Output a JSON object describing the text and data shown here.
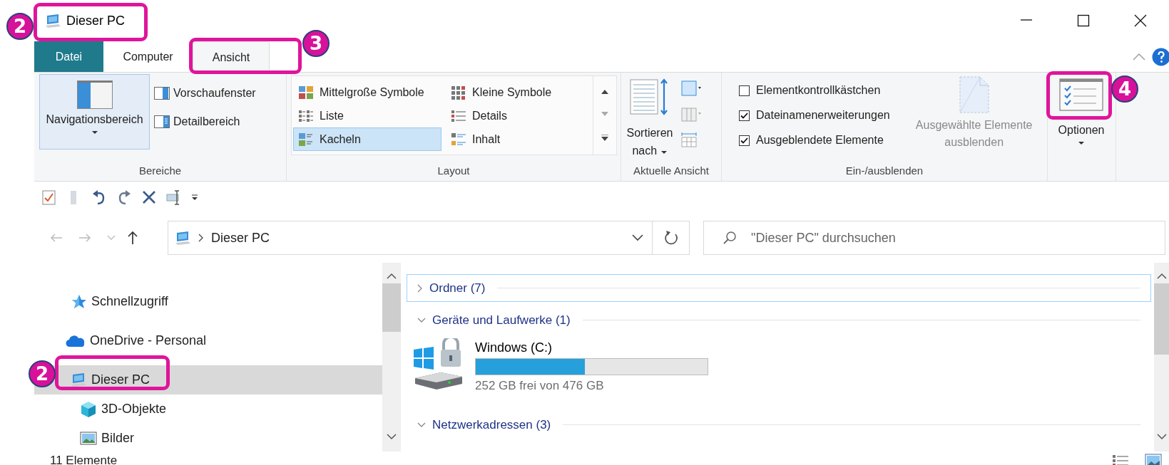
{
  "window": {
    "title": "Dieser PC"
  },
  "ribbon_tabs": [
    {
      "label": "Datei",
      "kind": "file",
      "selected": false
    },
    {
      "label": "Computer",
      "kind": "tab",
      "selected": false
    },
    {
      "label": "Ansicht",
      "kind": "tab",
      "selected": true
    }
  ],
  "ribbon": {
    "panes": {
      "label": "Bereiche",
      "navigation_pane": {
        "label": "Navigationsbereich",
        "selected": true
      },
      "buttons": [
        "Vorschaufenster",
        "Detailbereich"
      ]
    },
    "layout": {
      "label": "Layout",
      "options": [
        {
          "label": "Mittelgroße Symbole",
          "selected": false
        },
        {
          "label": "Kleine Symbole",
          "selected": false
        },
        {
          "label": "Liste",
          "selected": false
        },
        {
          "label": "Details",
          "selected": false
        },
        {
          "label": "Kacheln",
          "selected": true
        },
        {
          "label": "Inhalt",
          "selected": false
        }
      ]
    },
    "current_view": {
      "label": "Aktuelle Ansicht",
      "sort_button": "Sortieren nach"
    },
    "show_hide": {
      "label": "Ein-/ausblenden",
      "checkboxes": [
        {
          "label": "Elementkontrollkästchen",
          "checked": false
        },
        {
          "label": "Dateinamenerweiterungen",
          "checked": true
        },
        {
          "label": "Ausgeblendete Elemente",
          "checked": true
        }
      ],
      "hide_selected": {
        "label": "Ausgewählte Elemente ausblenden",
        "disabled": true
      }
    },
    "options": {
      "label": "Optionen"
    }
  },
  "address_bar": {
    "path": "Dieser PC"
  },
  "search": {
    "placeholder": "\"Dieser PC\" durchsuchen"
  },
  "nav_pane": {
    "items": [
      {
        "label": "Schnellzugriff",
        "selected": false
      },
      {
        "label": "OneDrive - Personal",
        "selected": false
      },
      {
        "label": "Dieser PC",
        "selected": true,
        "children": [
          {
            "label": "3D-Objekte",
            "selected": false
          },
          {
            "label": "Bilder",
            "selected": false
          }
        ]
      }
    ]
  },
  "content": {
    "groups": [
      {
        "label": "Ordner (7)",
        "expanded": false,
        "focused": true
      },
      {
        "label": "Geräte und Laufwerke (1)",
        "expanded": true,
        "focused": false,
        "drives": [
          {
            "name": "Windows (C:)",
            "level": 0.47,
            "free": "252 GB frei von 476 GB"
          }
        ]
      },
      {
        "label": "Netzwerkadressen (3)",
        "expanded": true,
        "focused": false
      }
    ]
  },
  "status_bar": {
    "item_count": "11 Elemente"
  },
  "annotations": [
    {
      "number": "2"
    },
    {
      "number": "3"
    },
    {
      "number": "4"
    },
    {
      "number": "2"
    }
  ]
}
